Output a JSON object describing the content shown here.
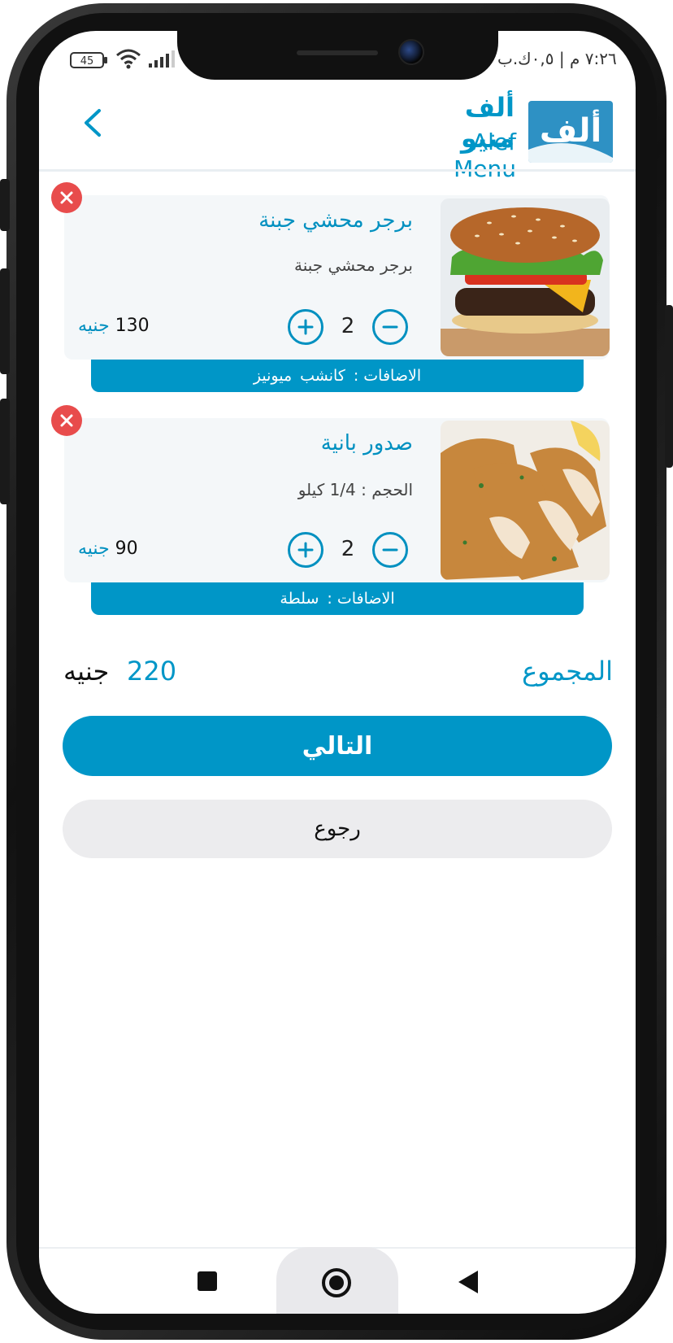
{
  "status_bar": {
    "time": "٧:٢٦ م | ٠,٥ك.ب",
    "battery": "45"
  },
  "header": {
    "brand_ar": "ألف منيو",
    "brand_en": "Alef Menu",
    "logo_glyph": "ألف"
  },
  "cart": {
    "items": [
      {
        "title": "برجر محشي جبنة",
        "subtitle": "برجر محشي جبنة",
        "quantity": "2",
        "price": "130",
        "currency": "جنيه",
        "addons_label": "الاضافات :",
        "addons": [
          "كانشب",
          "ميونيز"
        ]
      },
      {
        "title": "صدور بانية",
        "subtitle": "الحجم : 1/4 كيلو",
        "quantity": "2",
        "price": "90",
        "currency": "جنيه",
        "addons_label": "الاضافات :",
        "addons": [
          "سلطة"
        ]
      }
    ]
  },
  "total": {
    "label": "المجموع",
    "value": "220",
    "currency": "جنيه"
  },
  "actions": {
    "next_label": "التالي",
    "back_label": "رجوع"
  },
  "colors": {
    "accent": "#0096c7",
    "remove": "#e84c4c",
    "card_bg": "#f4f7f9"
  }
}
